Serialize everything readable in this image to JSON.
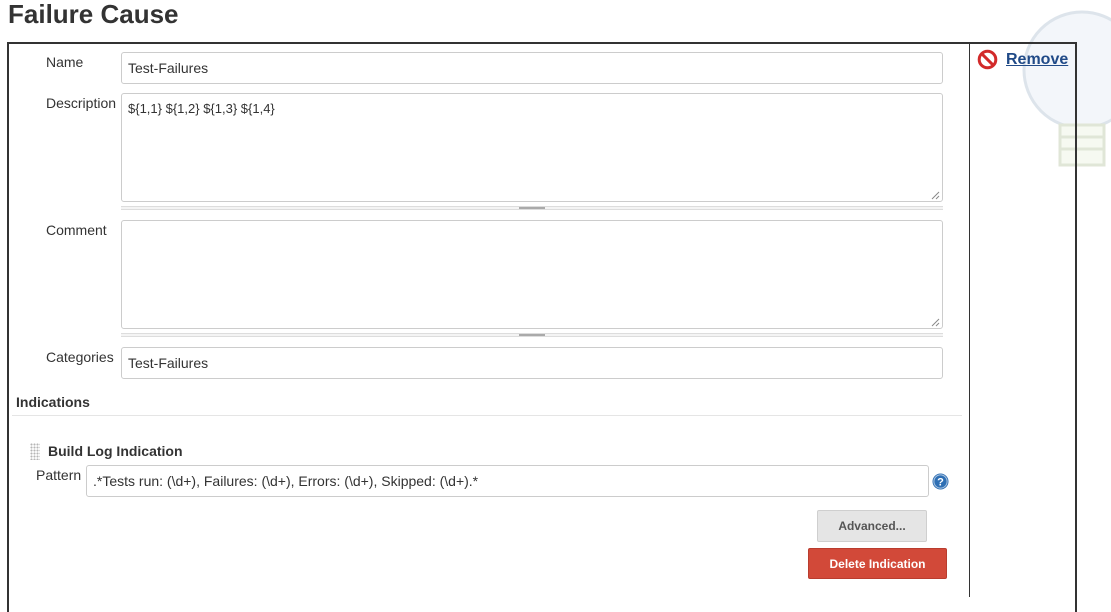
{
  "page": {
    "title": "Failure Cause"
  },
  "actions": {
    "remove_label": "Remove"
  },
  "fields": {
    "name": {
      "label": "Name",
      "value": "Test-Failures"
    },
    "description": {
      "label": "Description",
      "value": "${1,1} ${1,2} ${1,3} ${1,4}"
    },
    "comment": {
      "label": "Comment",
      "value": ""
    },
    "categories": {
      "label": "Categories",
      "value": "Test-Failures"
    }
  },
  "indications": {
    "heading": "Indications",
    "build_log": {
      "heading": "Build Log Indication",
      "pattern_label": "Pattern",
      "pattern_value": ".*Tests run: (\\d+), Failures: (\\d+), Errors: (\\d+), Skipped: (\\d+).*",
      "advanced_label": "Advanced...",
      "delete_label": "Delete Indication"
    }
  },
  "colors": {
    "remove_link": "#204a87",
    "delete_button": "#d24939",
    "help_icon": "#2e6fb4"
  },
  "icons": {
    "remove": "no-entry-icon",
    "help": "question-mark-icon",
    "drag": "drag-grip-icon",
    "background": "light-bulb-icon"
  }
}
